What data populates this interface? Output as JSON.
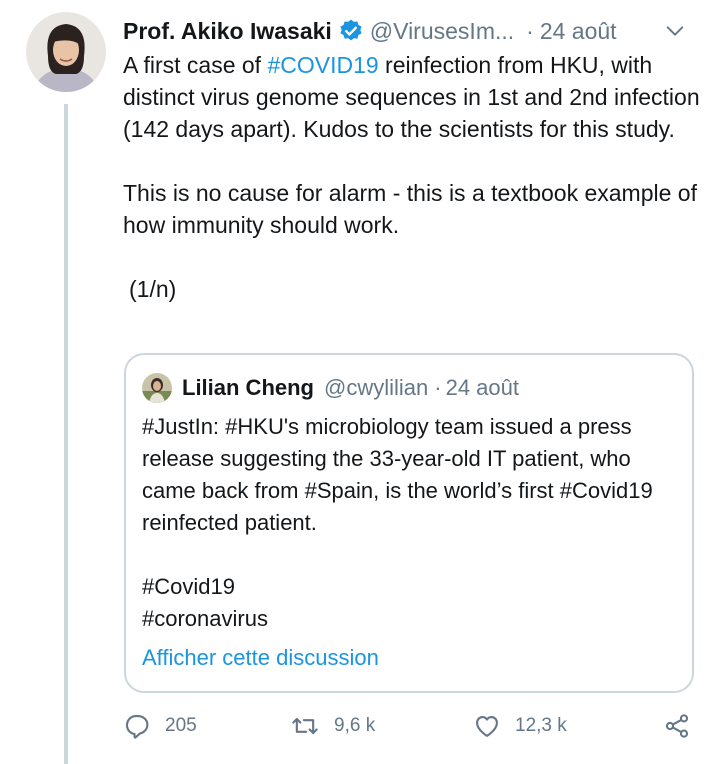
{
  "tweet": {
    "author_name": "Prof. Akiko Iwasaki",
    "handle": "@VirusesIm...",
    "separator": "·",
    "date": "24 août",
    "text_before_tag": "A first case of ",
    "hashtag": "#COVID19",
    "text_after_tag": " reinfection from HKU, with distinct virus genome sequences in 1st and 2nd infection (142 days apart). Kudos to the scientists for this study.",
    "paragraph2": "This is no cause for alarm - this is a textbook example of how immunity should work.",
    "paragraph3": "(1/n)"
  },
  "quoted_tweet": {
    "author_name": "Lilian Cheng",
    "handle": "@cwylilian",
    "separator": "·",
    "date": "24 août",
    "paragraph1": "#JustIn: #HKU's microbiology team issued a press release suggesting the 33-year-old IT patient, who came back from #Spain, is the world’s first #Covid19 reinfected patient.",
    "tag1": "#Covid19",
    "tag2": "#coronavirus",
    "show_thread_link": "Afficher cette discussion"
  },
  "actions": {
    "reply_count": "205",
    "retweet_count": "9,6 k",
    "like_count": "12,3 k"
  },
  "icons": {
    "verified": "verified-badge-icon",
    "more": "chevron-down-icon",
    "reply": "reply-icon",
    "retweet": "retweet-icon",
    "like": "heart-icon",
    "share": "share-icon"
  },
  "colors": {
    "link_blue": "#1b95e0",
    "secondary_gray": "#657786",
    "border_gray": "#ccd6dd",
    "text": "#14171a"
  }
}
